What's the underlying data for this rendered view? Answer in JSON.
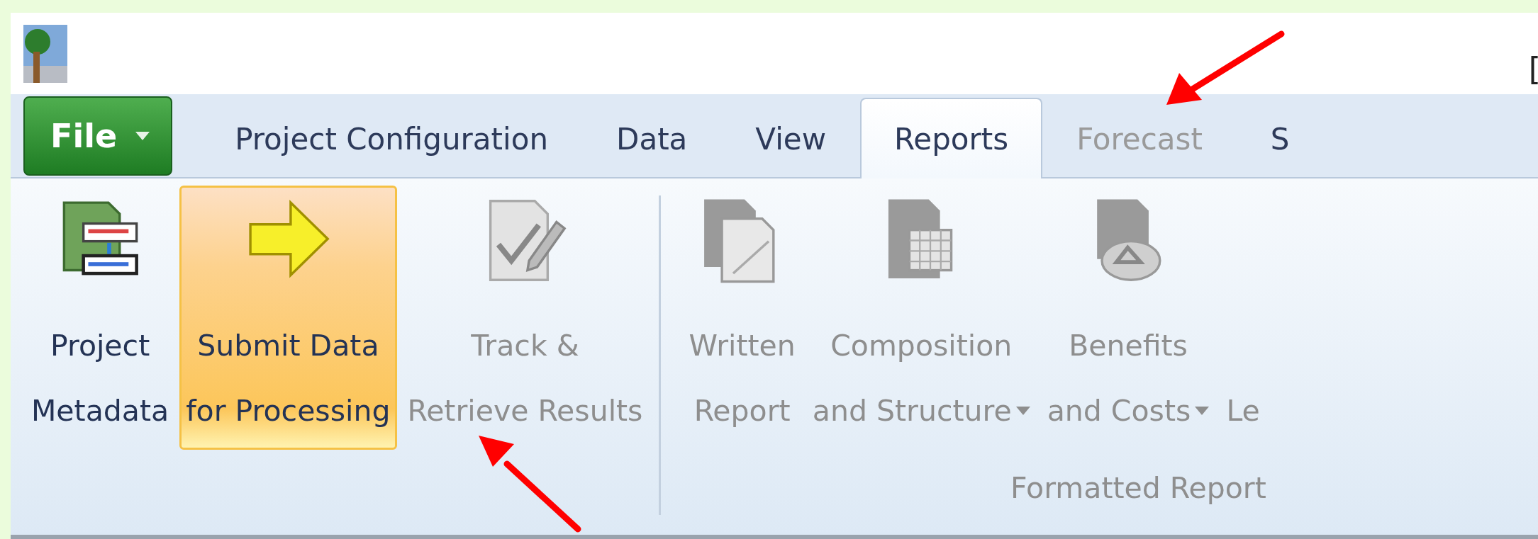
{
  "window": {
    "title": "["
  },
  "file_menu": {
    "label": "File"
  },
  "tabs": [
    {
      "label": "Project Configuration",
      "selected": false,
      "disabled": false
    },
    {
      "label": "Data",
      "selected": false,
      "disabled": false
    },
    {
      "label": "View",
      "selected": false,
      "disabled": false
    },
    {
      "label": "Reports",
      "selected": true,
      "disabled": false
    },
    {
      "label": "Forecast",
      "selected": false,
      "disabled": true
    },
    {
      "label": "S",
      "selected": false,
      "disabled": false
    }
  ],
  "ribbon_groups": [
    {
      "buttons": [
        {
          "lines": [
            "Project",
            "Metadata"
          ],
          "highlighted": false,
          "disabled": false,
          "dropdown": false
        },
        {
          "lines": [
            "Submit Data",
            "for Processing"
          ],
          "highlighted": true,
          "disabled": false,
          "dropdown": false
        },
        {
          "lines": [
            "Track &",
            "Retrieve Results"
          ],
          "highlighted": false,
          "disabled": true,
          "dropdown": false
        }
      ]
    },
    {
      "label": "Formatted Report",
      "buttons": [
        {
          "lines": [
            "Written",
            "Report"
          ],
          "highlighted": false,
          "disabled": true,
          "dropdown": false
        },
        {
          "lines": [
            "Composition",
            "and Structure"
          ],
          "highlighted": false,
          "disabled": true,
          "dropdown": true
        },
        {
          "lines": [
            "Benefits",
            "and Costs"
          ],
          "highlighted": false,
          "disabled": true,
          "dropdown": true
        },
        {
          "lines": [
            "Le"
          ],
          "highlighted": false,
          "disabled": true,
          "dropdown": false
        }
      ]
    }
  ]
}
